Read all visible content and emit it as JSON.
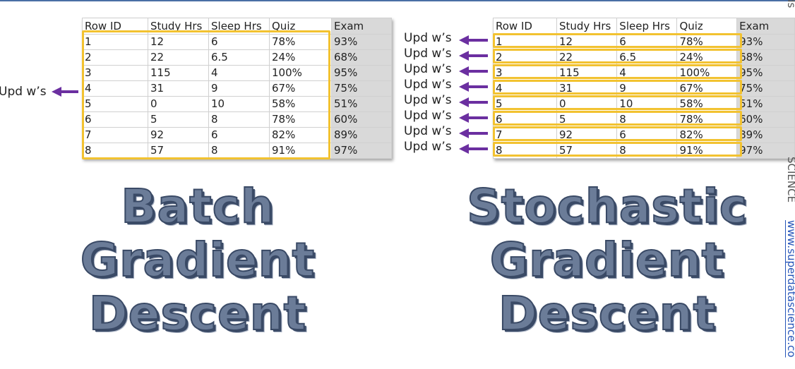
{
  "table": {
    "headers": [
      "Row ID",
      "Study Hrs",
      "Sleep Hrs",
      "Quiz",
      "Exam"
    ],
    "rows": [
      [
        "1",
        "12",
        "6",
        "78%",
        "93%"
      ],
      [
        "2",
        "22",
        "6.5",
        "24%",
        "68%"
      ],
      [
        "3",
        "115",
        "4",
        "100%",
        "95%"
      ],
      [
        "4",
        "31",
        "9",
        "67%",
        "75%"
      ],
      [
        "5",
        "0",
        "10",
        "58%",
        "51%"
      ],
      [
        "6",
        "5",
        "8",
        "78%",
        "60%"
      ],
      [
        "7",
        "92",
        "6",
        "82%",
        "89%"
      ],
      [
        "8",
        "57",
        "8",
        "91%",
        "97%"
      ]
    ]
  },
  "labels": {
    "update_weights": "Upd w’s"
  },
  "titles": {
    "left": [
      "Batch",
      "Gradient",
      "Descent"
    ],
    "right": [
      "Stochastic",
      "Gradient",
      "Descent"
    ]
  },
  "edge": {
    "top_fragment": "ds",
    "middle_fragment": "SCIENCE",
    "link_fragment": "www.superdatascience.co"
  },
  "colors": {
    "highlight": "#f2c230",
    "arrow": "#6b2fa0",
    "exam_column": "#d9d9d9",
    "title_fill": "#6b7c98"
  }
}
